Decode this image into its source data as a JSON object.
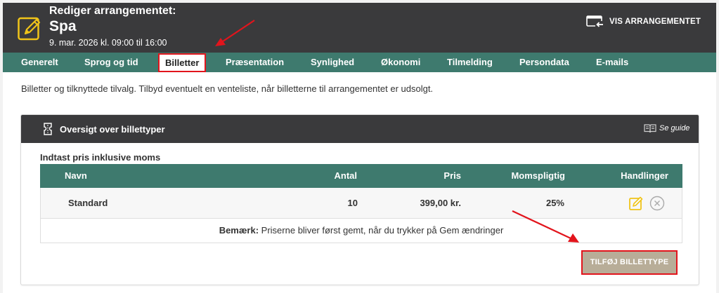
{
  "header": {
    "label": "Rediger arrangementet:",
    "title": "Spa",
    "date": "9. mar. 2026 kl. 09:00 til 16:00",
    "view_button": "VIS ARRANGEMENTET",
    "icon": "edit-icon"
  },
  "tabs": [
    {
      "label": "Generelt"
    },
    {
      "label": "Sprog og tid"
    },
    {
      "label": "Billetter",
      "active": true
    },
    {
      "label": "Præsentation"
    },
    {
      "label": "Synlighed"
    },
    {
      "label": "Økonomi"
    },
    {
      "label": "Tilmelding"
    },
    {
      "label": "Persondata"
    },
    {
      "label": "E-mails"
    }
  ],
  "description": "Billetter og tilknyttede tilvalg. Tilbyd eventuelt en venteliste, når billetterne til arrangementet er udsolgt.",
  "panel": {
    "title": "Oversigt over billettyper",
    "guide_label": "Se guide",
    "price_note": "Indtast pris inklusive moms",
    "columns": {
      "name": "Navn",
      "count": "Antal",
      "price": "Pris",
      "vat": "Momspligtig",
      "actions": "Handlinger"
    },
    "rows": [
      {
        "name": "Standard",
        "count": "10",
        "price": "399,00 kr.",
        "vat": "25%"
      }
    ],
    "note_label": "Bemærk:",
    "note_text": "Priserne bliver først gemt, når du trykker på Gem ændringer",
    "add_button": "TILFØJ BILLETTYPE"
  },
  "colors": {
    "header_bg": "#3a3a3c",
    "accent_green": "#3e7a6e",
    "highlight_red": "#e2141c",
    "icon_yellow": "#f0c419",
    "button_tan": "#b8ad98"
  }
}
